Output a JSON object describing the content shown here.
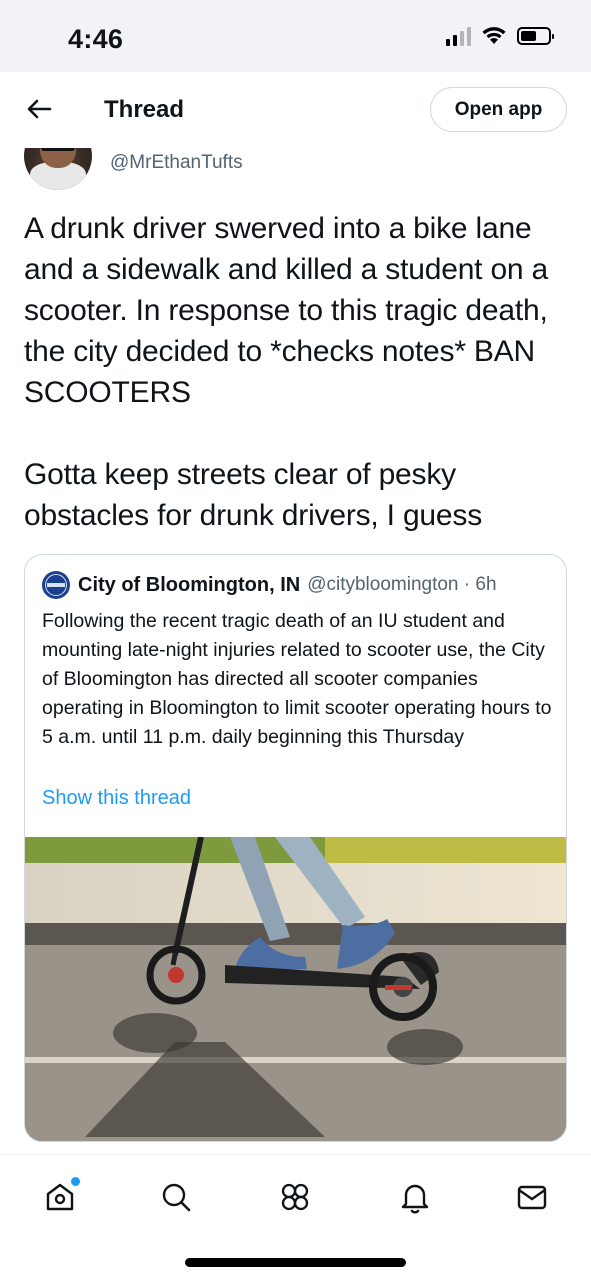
{
  "status_bar": {
    "time": "4:46"
  },
  "header": {
    "title": "Thread",
    "open_app_label": "Open app"
  },
  "author": {
    "handle": "@MrEthanTufts"
  },
  "tweet": {
    "text": "A drunk driver swerved into a bike lane and a sidewalk and killed a student on a scooter. In response to this tragic death, the city decided to *checks notes* BAN SCOOTERS\n\nGotta keep streets clear of pesky obstacles for drunk drivers, I guess"
  },
  "quote": {
    "name": "City of Bloomington, IN",
    "handle_time": "@citybloomington · 6h",
    "text": "Following the recent tragic death of an IU student and mounting late-night injuries related to scooter use, the City of Bloomington has directed all scooter companies operating in Bloomington to limit scooter operating hours to 5 a.m. until 11 p.m. daily beginning this Thursday",
    "show_thread": "Show this thread"
  },
  "nav": {
    "items": [
      "home-icon",
      "search-icon",
      "communities-icon",
      "notifications-icon",
      "messages-icon"
    ],
    "accent": "#1d9bf0"
  }
}
